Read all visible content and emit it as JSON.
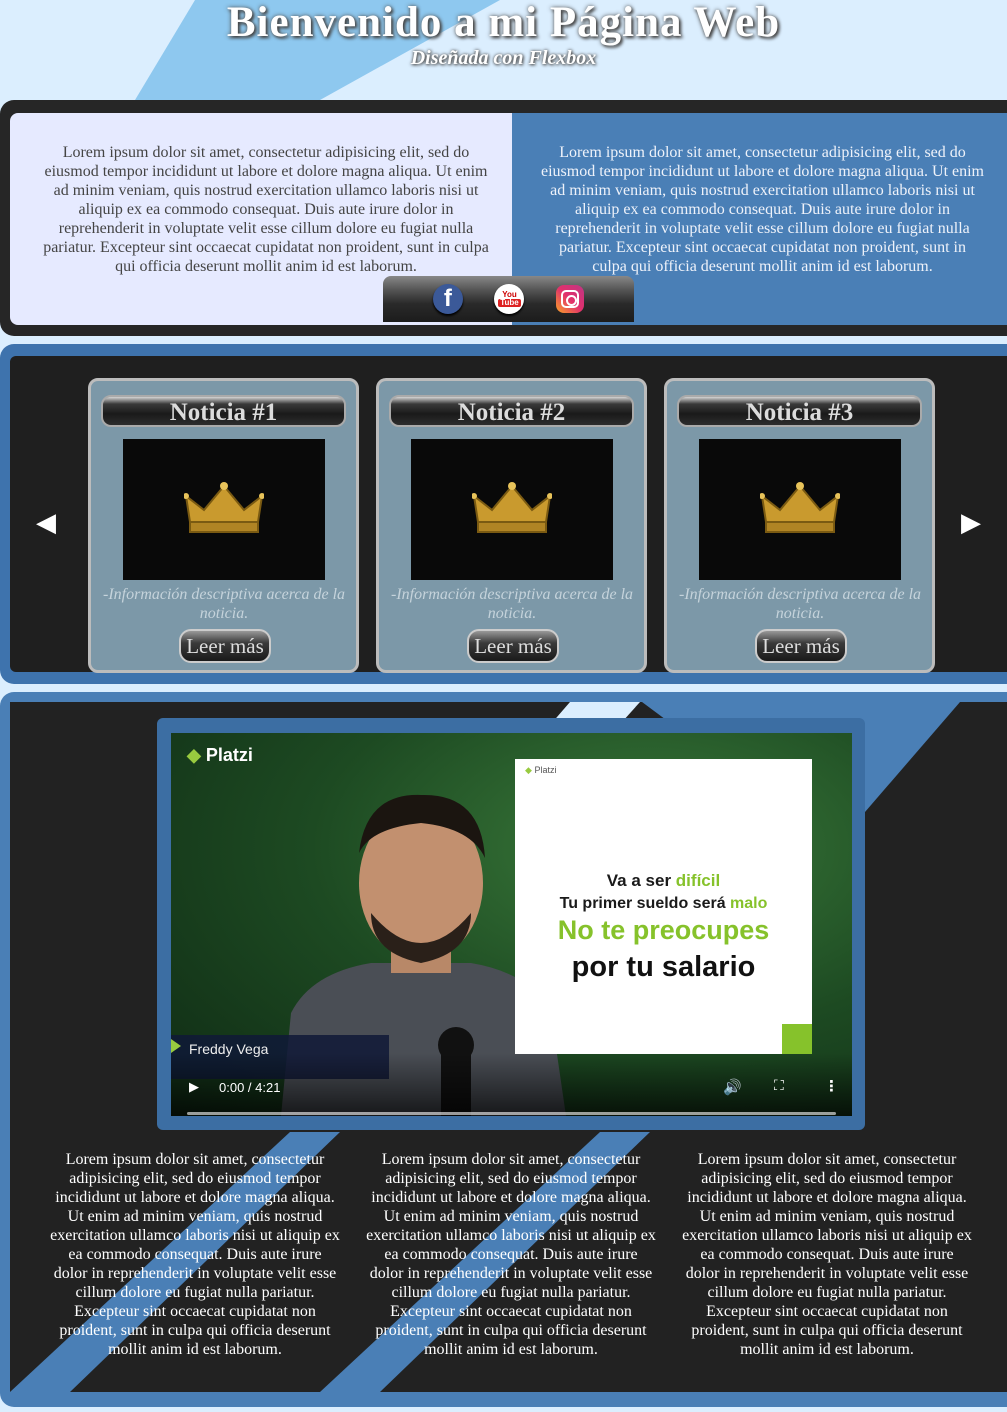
{
  "header": {
    "title": "Bienvenido a mi Página Web",
    "subtitle": "Diseñada con Flexbox"
  },
  "intro": {
    "left_text": "Lorem ipsum dolor sit amet, consectetur adipisicing elit, sed do eiusmod tempor incididunt ut labore et dolore magna aliqua. Ut enim ad minim veniam, quis nostrud exercitation ullamco laboris nisi ut aliquip ex ea commodo consequat. Duis aute irure dolor in reprehenderit in voluptate velit esse cillum dolore eu fugiat nulla pariatur. Excepteur sint occaecat cupidatat non proident, sunt in culpa qui officia deserunt mollit anim id est laborum.",
    "right_text": "Lorem ipsum dolor sit amet, consectetur adipisicing elit, sed do eiusmod tempor incididunt ut labore et dolore magna aliqua. Ut enim ad minim veniam, quis nostrud exercitation ullamco laboris nisi ut aliquip ex ea commodo consequat. Duis aute irure dolor in reprehenderit in voluptate velit esse cillum dolore eu fugiat nulla pariatur. Excepteur sint occaecat cupidatat non proident, sunt in culpa qui officia deserunt mollit anim id est laborum."
  },
  "social": {
    "facebook": "f",
    "youtube_top": "You",
    "youtube_bottom": "Tube"
  },
  "news": {
    "prev": "◀",
    "next": "▶",
    "cards": [
      {
        "title": "Noticia #1",
        "desc": "-Información descriptiva acerca de la noticia.",
        "button": "Leer más"
      },
      {
        "title": "Noticia #2",
        "desc": "-Información descriptiva acerca de la noticia.",
        "button": "Leer más"
      },
      {
        "title": "Noticia #3",
        "desc": "-Información descriptiva acerca de la noticia.",
        "button": "Leer más"
      }
    ]
  },
  "video": {
    "logo": "Platzi",
    "card_small": "Platzi",
    "line1_a": "Va a ser ",
    "line1_b": "difícil",
    "line2_a": "Tu primer sueldo será ",
    "line2_b": "malo",
    "line3": "No te preocupes",
    "line4": "por tu salario",
    "presenter": "Freddy Vega",
    "time": "0:00 / 4:21",
    "play": "▶",
    "volume": "🔊",
    "fullscreen": "⛶",
    "more": "⋮"
  },
  "columns": [
    "Lorem ipsum dolor sit amet, consectetur adipisicing elit, sed do eiusmod tempor incididunt ut labore et dolore magna aliqua. Ut enim ad minim veniam, quis nostrud exercitation ullamco laboris nisi ut aliquip ex ea commodo consequat. Duis aute irure dolor in reprehenderit in voluptate velit esse cillum dolore eu fugiat nulla pariatur. Excepteur sint occaecat cupidatat non proident, sunt in culpa qui officia deserunt mollit anim id est laborum.",
    "Lorem ipsum dolor sit amet, consectetur adipisicing elit, sed do eiusmod tempor incididunt ut labore et dolore magna aliqua. Ut enim ad minim veniam, quis nostrud exercitation ullamco laboris nisi ut aliquip ex ea commodo consequat. Duis aute irure dolor in reprehenderit in voluptate velit esse cillum dolore eu fugiat nulla pariatur. Excepteur sint occaecat cupidatat non proident, sunt in culpa qui officia deserunt mollit anim id est laborum.",
    "Lorem ipsum dolor sit amet, consectetur adipisicing elit, sed do eiusmod tempor incididunt ut labore et dolore magna aliqua. Ut enim ad minim veniam, quis nostrud exercitation ullamco laboris nisi ut aliquip ex ea commodo consequat. Duis aute irure dolor in reprehenderit in voluptate velit esse cillum dolore eu fugiat nulla pariatur. Excepteur sint occaecat cupidatat non proident, sunt in culpa qui officia deserunt mollit anim id est laborum."
  ],
  "colors": {
    "accent_blue": "#4a7fb6",
    "light_panel": "#e6eaff",
    "card_bg": "#7c98a8",
    "dark": "#222222"
  }
}
